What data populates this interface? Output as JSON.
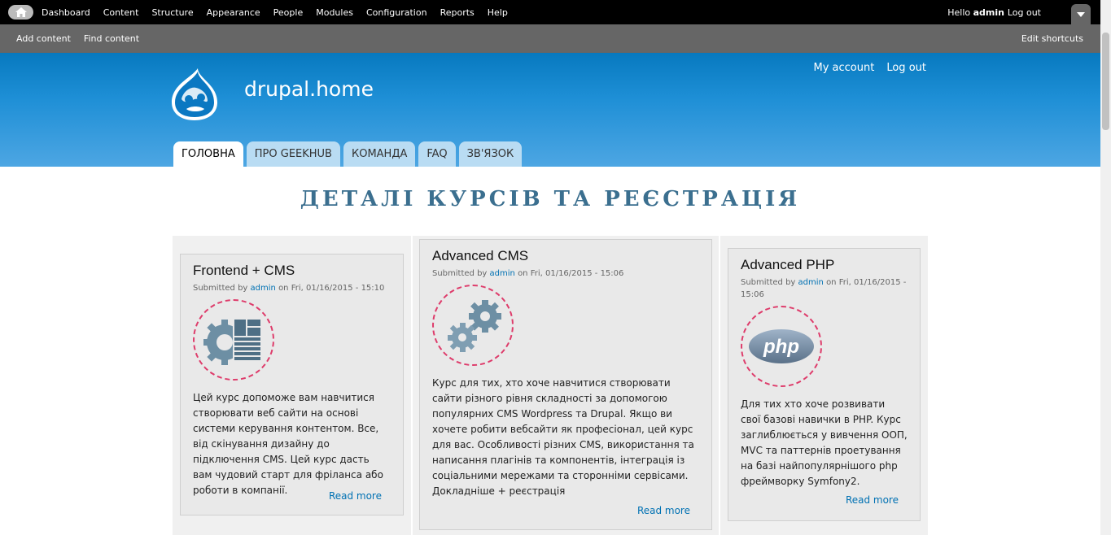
{
  "toolbar": {
    "menu": [
      "Dashboard",
      "Content",
      "Structure",
      "Appearance",
      "People",
      "Modules",
      "Configuration",
      "Reports",
      "Help"
    ],
    "hello": "Hello",
    "username": "admin",
    "logout": "Log out"
  },
  "shortcuts": {
    "items": [
      "Add content",
      "Find content"
    ],
    "edit": "Edit shortcuts"
  },
  "header": {
    "site_name": "drupal.home",
    "secondary": [
      "My account",
      "Log out"
    ]
  },
  "tabs": [
    "ГОЛОВНА",
    "ПРО GEEKHUB",
    "КОМАНДА",
    "FAQ",
    "ЗВ'ЯЗОК"
  ],
  "active_tab": "ГОЛОВНА",
  "page_title": "ДЕТАЛІ КУРСІВ ТА РЕЄСТРАЦІЯ",
  "cards": [
    {
      "title": "Frontend + CMS",
      "submitted": "Submitted by",
      "author": "admin",
      "date": "on Fri, 01/16/2015 - 15:10",
      "icon": "frontend-cms-gear-grid-icon",
      "body": "Цей курс допоможе вам навчитися створювати веб сайти на основі системи керування контентом. Все, від скінування дизайну до підключення CMS. Цей курс дасть вам чудовий старт для фріланса або роботи в компанії.",
      "read_more": "Read more"
    },
    {
      "title": "Advanced CMS",
      "submitted": "Submitted by",
      "author": "admin",
      "date": "on Fri, 01/16/2015 - 15:06",
      "icon": "gears-icon",
      "body": "Курс для тих, хто хоче навчитися створювати сайти різного рівня складності за допомогою популярних CMS Wordpress та Drupal. Якщо ви хочете робити вебсайти як професіонал, цей курс для вас. Особливості різних CMS, використання та написання плагінів та компонентів, інтеграція із соціальними мережами та сторонніми сервісами.",
      "body_extra": "Докладніше + реєстрація",
      "read_more": "Read more"
    },
    {
      "title": "Advanced PHP",
      "submitted": "Submitted by",
      "author": "admin",
      "date": "on Fri, 01/16/2015 - 15:06",
      "icon": "php-logo-icon",
      "logo_text": "php",
      "body": "Для тих хто хоче розвивати свої базові навички в PHP. Курс заглиблюється у вивчення ООП, MVC та паттернів проетування на базі найпопулярнішого php фреймворку Symfony2.",
      "read_more": "Read more"
    }
  ],
  "colors": {
    "toolbar_bg": "#000000",
    "shortcuts_bg": "#666666",
    "header_blue": "#0779bf",
    "link": "#0071b3",
    "title_color": "#3b6f8f",
    "dashed_circle": "#de3c6b"
  }
}
